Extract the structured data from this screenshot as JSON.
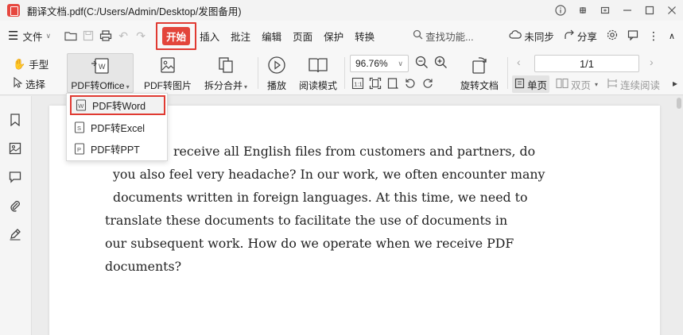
{
  "titlebar": {
    "title": "翻译文档.pdf(C:/Users/Admin/Desktop/发图备用)"
  },
  "menubar": {
    "file_label": "文件",
    "tabs": [
      "开始",
      "插入",
      "批注",
      "编辑",
      "页面",
      "保护",
      "转换"
    ],
    "active_tab": "开始",
    "search_label": "查找功能...",
    "sync_label": "未同步",
    "share_label": "分享"
  },
  "toolbar": {
    "hand_label": "手型",
    "select_label": "选择",
    "pdf_to_office_label": "PDF转Office",
    "pdf_to_image_label": "PDF转图片",
    "split_merge_label": "拆分合并",
    "play_label": "播放",
    "read_mode_label": "阅读模式",
    "zoom_value": "96.76%",
    "rotate_doc_label": "旋转文档",
    "page_indicator": "1/1",
    "single_page_label": "单页",
    "double_page_label": "双页",
    "continuous_read_label": "连续阅读"
  },
  "dropdown": {
    "items": [
      "PDF转Word",
      "PDF转Excel",
      "PDF转PPT"
    ],
    "highlighted": "PDF转Word"
  },
  "document": {
    "lines": [
      "receive all English files from customers and partners, do",
      "you also feel very headache? In our work, we often encounter many",
      "documents written in foreign languages. At this time, we need to",
      "translate these documents to facilitate the use of documents in",
      "our subsequent work. How do we operate when we receive PDF",
      "documents?"
    ]
  },
  "colors": {
    "accent": "#e3453b",
    "highlight_border": "#e03a32"
  }
}
